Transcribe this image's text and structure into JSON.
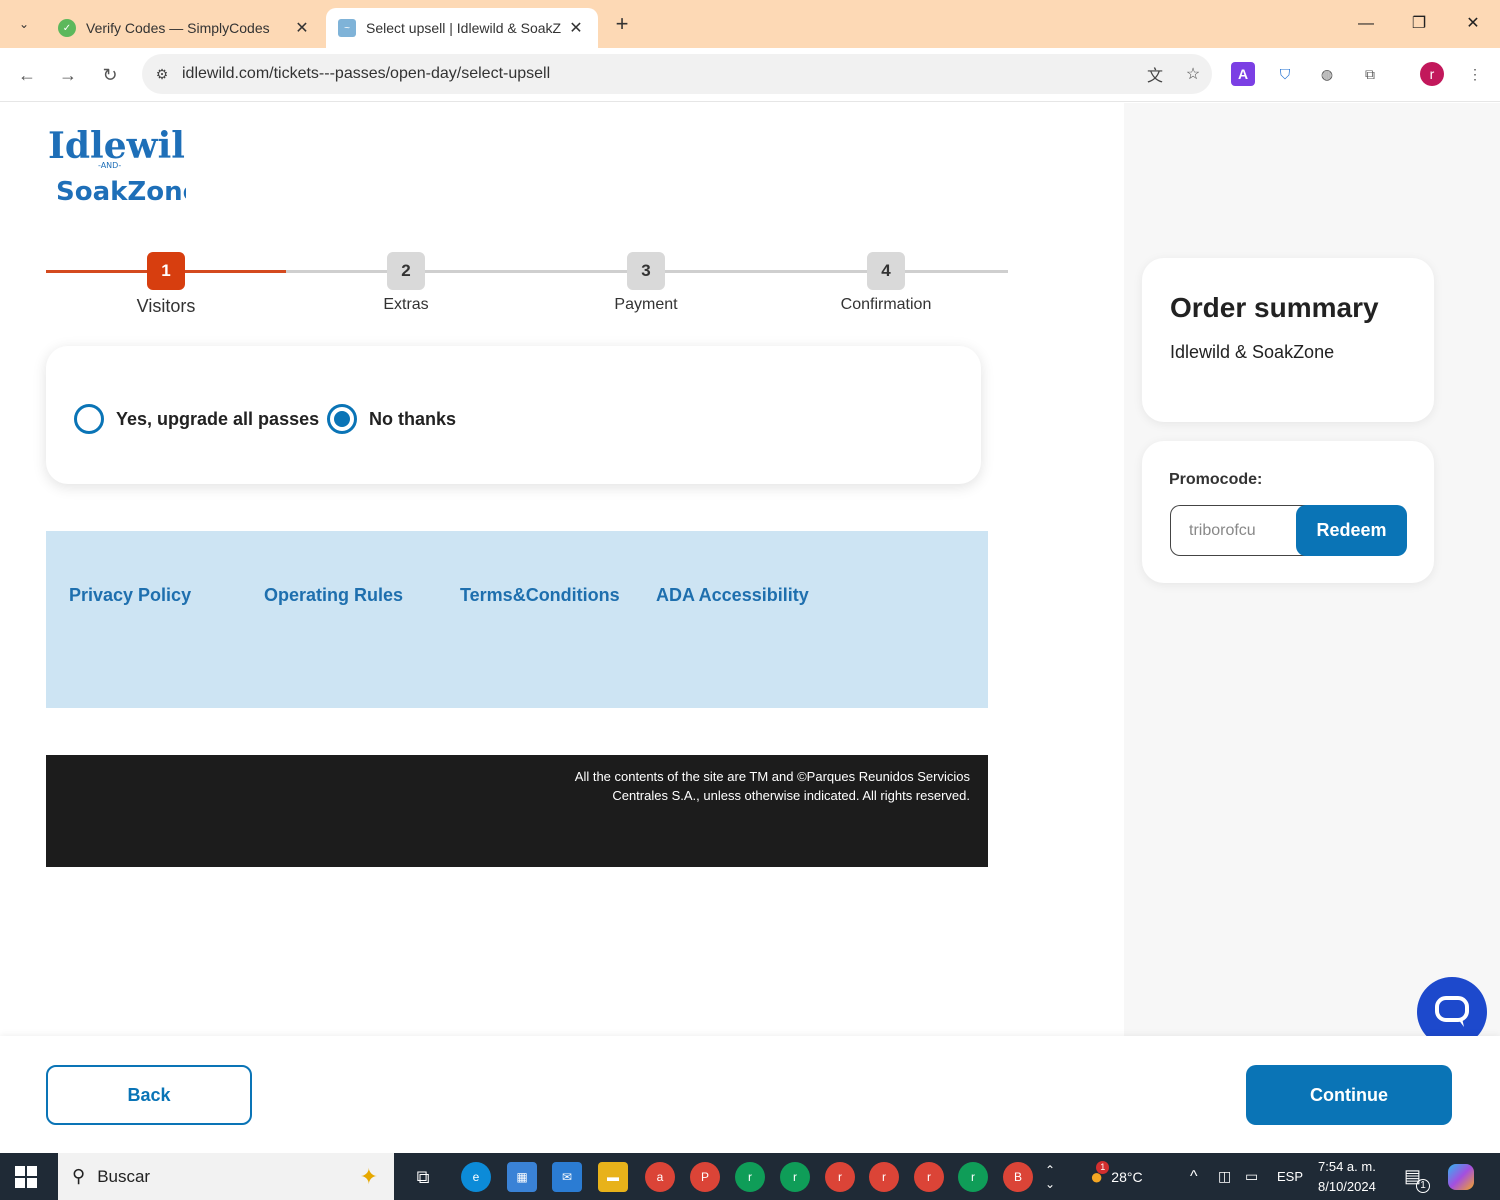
{
  "browser": {
    "tabs": [
      {
        "title": "Verify Codes — SimplyCodes",
        "active": false
      },
      {
        "title": "Select upsell | Idlewild & SoakZ",
        "active": true
      }
    ],
    "url": "idlewild.com/tickets---passes/open-day/select-upsell",
    "profile_initial": "r"
  },
  "logo": {
    "line1": "Idlewild",
    "and": "-AND-",
    "line2": "SoakZone"
  },
  "stepper": {
    "steps": [
      {
        "num": "1",
        "label": "Visitors"
      },
      {
        "num": "2",
        "label": "Extras"
      },
      {
        "num": "3",
        "label": "Payment"
      },
      {
        "num": "4",
        "label": "Confirmation"
      }
    ],
    "active_index": 0
  },
  "upsell": {
    "options": [
      {
        "label": "Yes, upgrade all passes",
        "checked": false
      },
      {
        "label": "No thanks",
        "checked": true
      }
    ]
  },
  "footer": {
    "links": [
      "Privacy Policy",
      "Operating Rules",
      "Terms&Conditions",
      "ADA Accessibility"
    ],
    "copyright_line1": "All the contents of the site are TM and ©Parques Reunidos Servicios",
    "copyright_line2": "Centrales S.A., unless otherwise indicated. All rights reserved."
  },
  "order_summary": {
    "title": "Order summary",
    "park": "Idlewild & SoakZone"
  },
  "promo": {
    "label": "Promocode:",
    "value": "triborofcu",
    "redeem_label": "Redeem"
  },
  "actions": {
    "back_label": "Back",
    "continue_label": "Continue"
  },
  "taskbar": {
    "search_placeholder": "Buscar",
    "weather": "28°C",
    "language": "ESP",
    "time": "7:54 a. m.",
    "date": "8/10/2024",
    "weather_badge": "1",
    "notif_count": "1",
    "app_letters": [
      "a",
      "P",
      "r",
      "r",
      "r",
      "r",
      "r",
      "r",
      "B"
    ]
  },
  "colors": {
    "brand_blue": "#0a74b6",
    "active_step": "#d73e0f",
    "tab_strip": "#fdd9b5",
    "links_bar": "#cde4f3",
    "chat": "#1d49cc"
  }
}
